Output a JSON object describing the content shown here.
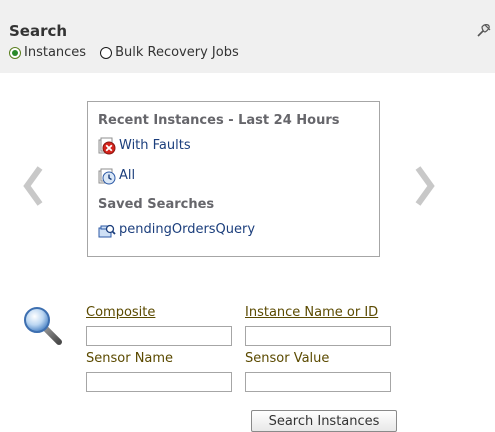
{
  "header": {
    "title": "Search",
    "radio_options": [
      {
        "label": "Instances",
        "selected": true
      },
      {
        "label": "Bulk Recovery Jobs",
        "selected": false
      }
    ],
    "pin_icon": "pin-icon"
  },
  "recent": {
    "heading": "Recent Instances - Last 24 Hours",
    "links": [
      {
        "label": "With Faults",
        "icon": "faults-icon"
      },
      {
        "label": "All",
        "icon": "clock-icon"
      }
    ],
    "saved_heading": "Saved Searches",
    "saved": [
      {
        "label": "pendingOrdersQuery",
        "icon": "saved-search-icon"
      }
    ]
  },
  "form": {
    "composite_label": "Composite",
    "composite_value": "",
    "instance_label": "Instance Name or ID",
    "instance_value": "",
    "sensor_name_label": "Sensor Name",
    "sensor_name_value": "",
    "sensor_value_label": "Sensor Value",
    "sensor_value_value": "",
    "search_button": "Search Instances"
  },
  "colors": {
    "header_bg": "#f0f0f0",
    "link": "#1b3e7c",
    "label": "#5b4a00",
    "heading": "#66666b"
  }
}
